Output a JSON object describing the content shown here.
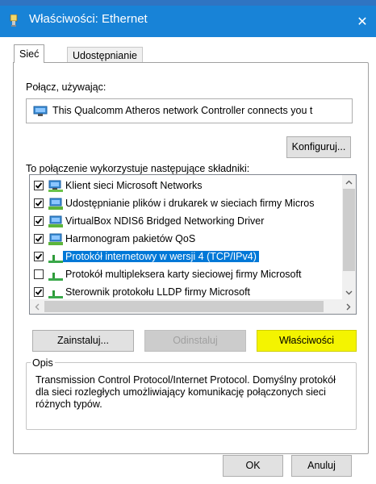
{
  "window": {
    "title": "Właściwości: Ethernet",
    "close_glyph": "✕"
  },
  "tabs": [
    {
      "label": "Sieć",
      "active": true
    },
    {
      "label": "Udostępnianie",
      "active": false
    }
  ],
  "connect_using": {
    "label": "Połącz, używając:",
    "adapter_name": "This Qualcomm Atheros network Controller connects you t",
    "adapter_icon": "network-adapter-icon"
  },
  "buttons": {
    "configure": "Konfiguruj...",
    "install": "Zainstaluj...",
    "uninstall": "Odinstaluj",
    "properties": "Właściwości",
    "ok": "OK",
    "cancel": "Anuluj"
  },
  "components": {
    "label": "To połączenie wykorzystuje następujące składniki:",
    "items": [
      {
        "label": "Klient sieci Microsoft Networks",
        "checked": true,
        "icon": "network-client-icon",
        "selected": false
      },
      {
        "label": "Udostępnianie plików i drukarek w sieciach firmy Micros",
        "checked": true,
        "icon": "network-service-icon",
        "selected": false
      },
      {
        "label": "VirtualBox NDIS6 Bridged Networking Driver",
        "checked": true,
        "icon": "network-service-icon",
        "selected": false
      },
      {
        "label": "Harmonogram pakietów QoS",
        "checked": true,
        "icon": "network-service-icon",
        "selected": false
      },
      {
        "label": "Protokół internetowy w wersji 4 (TCP/IPv4)",
        "checked": true,
        "icon": "protocol-icon",
        "selected": true
      },
      {
        "label": "Protokół multipleksera karty sieciowej firmy Microsoft",
        "checked": false,
        "icon": "protocol-icon",
        "selected": false
      },
      {
        "label": "Sterownik protokołu LLDP firmy Microsoft",
        "checked": true,
        "icon": "protocol-icon",
        "selected": false
      }
    ]
  },
  "description": {
    "legend": "Opis",
    "text": "Transmission Control Protocol/Internet Protocol. Domyślny protokół dla sieci rozległych umożliwiający komunikację połączonych sieci różnych typów."
  },
  "colors": {
    "titlebar": "#1883d7",
    "selection": "#0078d7",
    "highlight": "#f4f400"
  }
}
